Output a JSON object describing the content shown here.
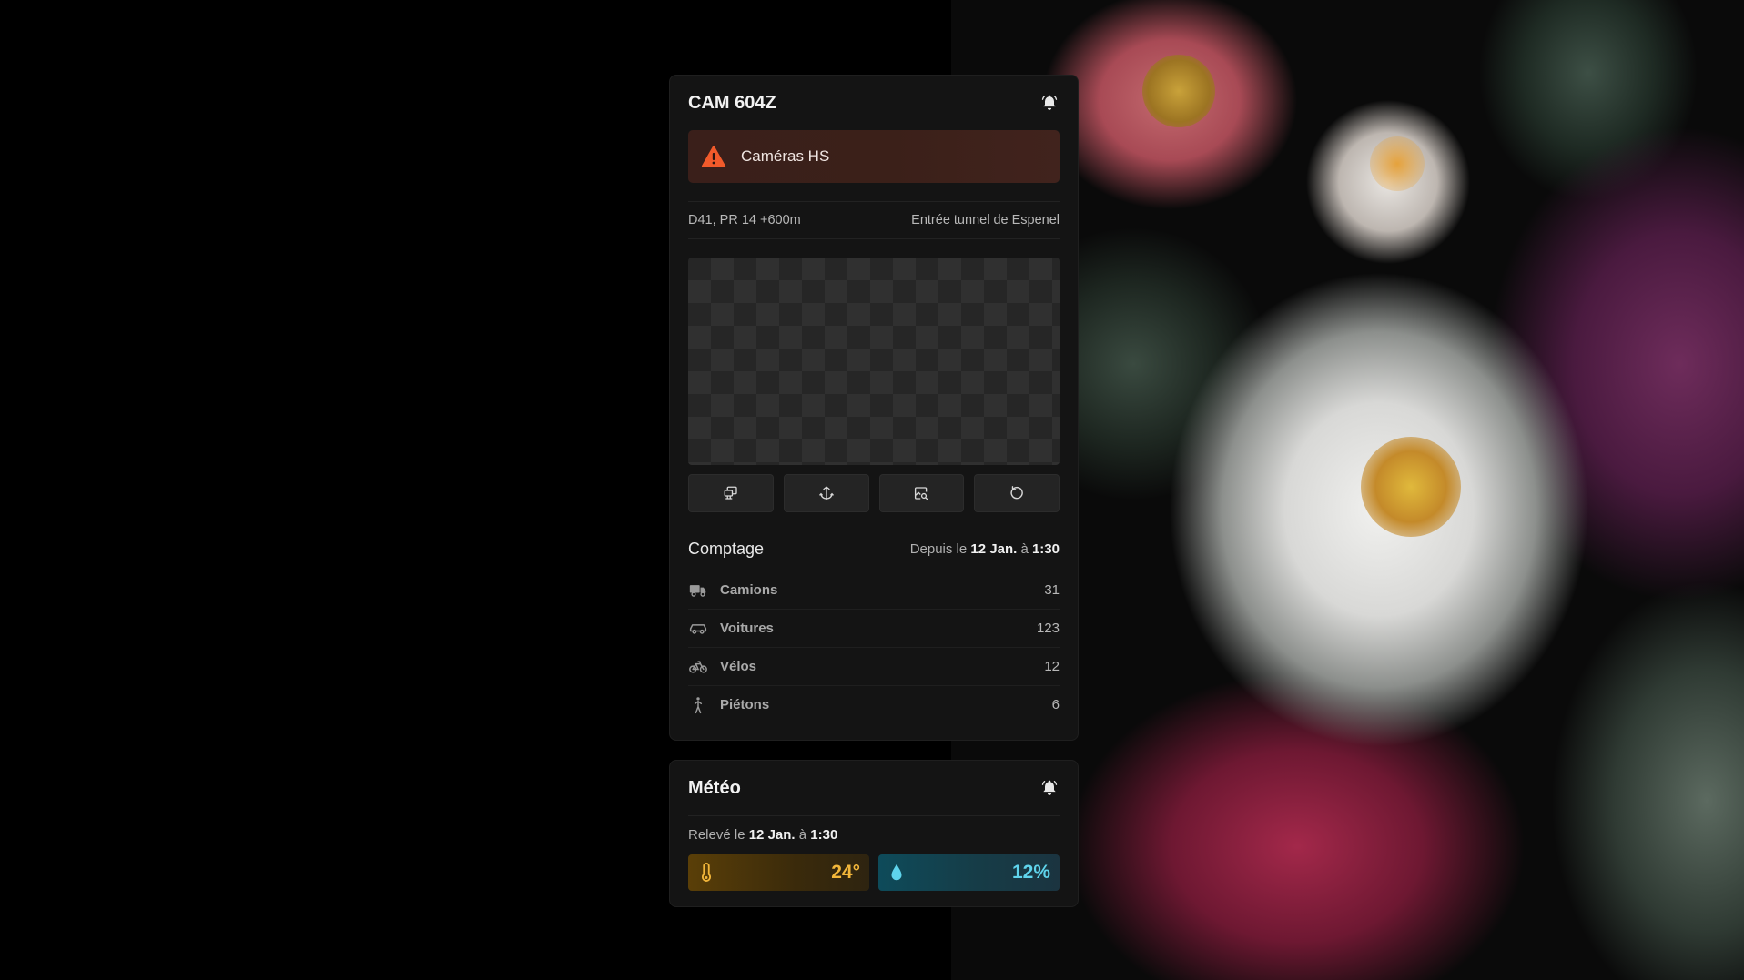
{
  "camera": {
    "title": "CAM 604Z",
    "alert_text": "Caméras HS",
    "location_road": "D41, PR 14 +600m",
    "location_name": "Entrée tunnel de Espenel",
    "controls": [
      "screen-icon",
      "anchor-icon",
      "search-image-icon",
      "refresh-icon"
    ]
  },
  "comptage": {
    "title": "Comptage",
    "since_prefix": "Depuis le",
    "since_date": "12 Jan.",
    "since_at": "à",
    "since_time": "1:30",
    "rows": [
      {
        "label": "Camions",
        "value": "31",
        "icon": "truck-icon"
      },
      {
        "label": "Voitures",
        "value": "123",
        "icon": "car-icon"
      },
      {
        "label": "Vélos",
        "value": "12",
        "icon": "bicycle-icon"
      },
      {
        "label": "Piétons",
        "value": "6",
        "icon": "pedestrian-icon"
      }
    ]
  },
  "meteo": {
    "title": "Météo",
    "date_prefix": "Relevé le",
    "date": "12 Jan.",
    "at": "à",
    "time": "1:30",
    "temperature": "24°",
    "humidity": "12%"
  },
  "colors": {
    "alert": "#f15a2b",
    "temperature": "#f2b63a",
    "humidity": "#5fd4ec"
  }
}
